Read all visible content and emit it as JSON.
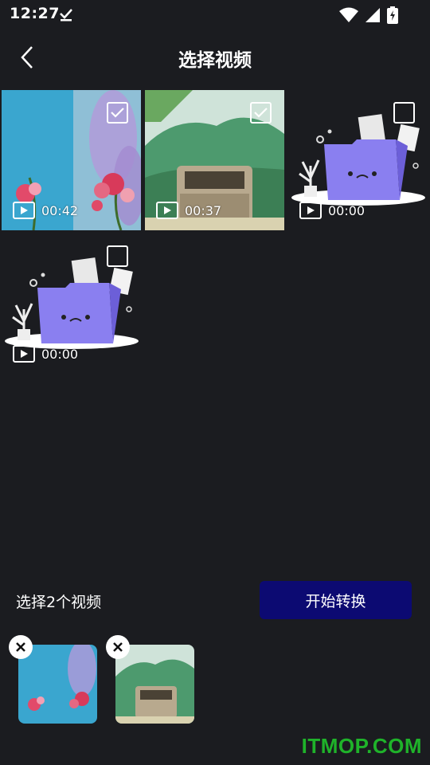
{
  "status_bar": {
    "time": "12:27"
  },
  "header": {
    "title": "选择视频"
  },
  "videos": [
    {
      "duration": "00:42",
      "selected": true,
      "thumb": "flowers"
    },
    {
      "duration": "00:37",
      "selected": true,
      "thumb": "truck"
    },
    {
      "duration": "00:00",
      "selected": false,
      "thumb": "empty-folder"
    },
    {
      "duration": "00:00",
      "selected": false,
      "thumb": "empty-folder"
    }
  ],
  "footer": {
    "selected_count_label": "选择2个视频",
    "start_button_label": "开始转换"
  },
  "selected_thumbs": [
    {
      "thumb": "flowers"
    },
    {
      "thumb": "truck"
    }
  ],
  "watermark": "ITMOP.COM",
  "colors": {
    "background": "#1b1c20",
    "start_button": "#0c0a72",
    "folder": "#8a7ff0",
    "watermark": "#1fb32a"
  }
}
